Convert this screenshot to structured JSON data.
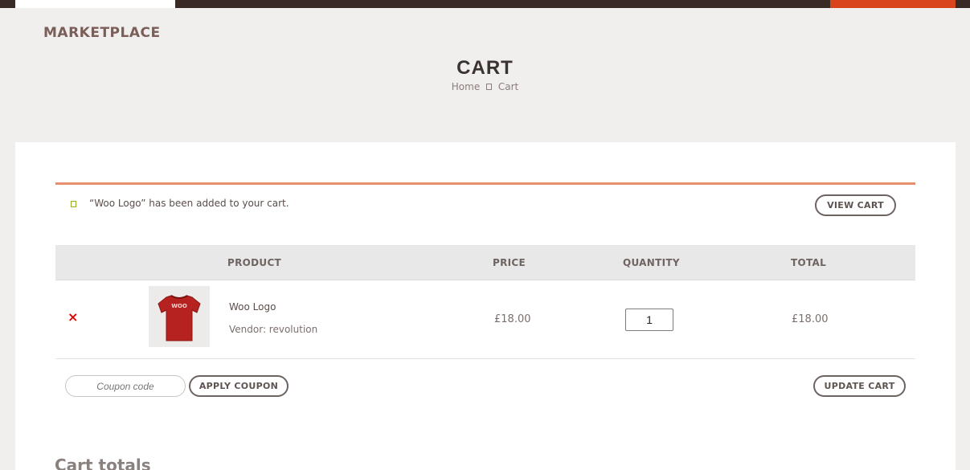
{
  "site": {
    "title": "MARKETPLACE"
  },
  "header": {
    "page_title": "CART",
    "breadcrumb": {
      "home": "Home",
      "current": "Cart"
    }
  },
  "notice": {
    "message": "“Woo Logo” has been added to your cart.",
    "view_cart_label": "VIEW CART"
  },
  "cart_table": {
    "columns": {
      "product": "PRODUCT",
      "price": "PRICE",
      "quantity": "QUANTITY",
      "total": "TOTAL"
    },
    "items": [
      {
        "remove_symbol": "×",
        "name": "Woo Logo",
        "vendor": "Vendor: revolution",
        "price": "£18.00",
        "quantity": "1",
        "total": "£18.00",
        "thumb_text": "WOO"
      }
    ]
  },
  "actions": {
    "coupon_placeholder": "Coupon code",
    "apply_coupon_label": "APPLY COUPON",
    "update_cart_label": "UPDATE CART"
  },
  "totals": {
    "title": "Cart totals"
  },
  "colors": {
    "topbar": "#3a2a26",
    "accent_orange": "#d9441c",
    "notice_border": "#e6906e",
    "remove_red": "#e10000",
    "shirt_red": "#b5221f"
  }
}
